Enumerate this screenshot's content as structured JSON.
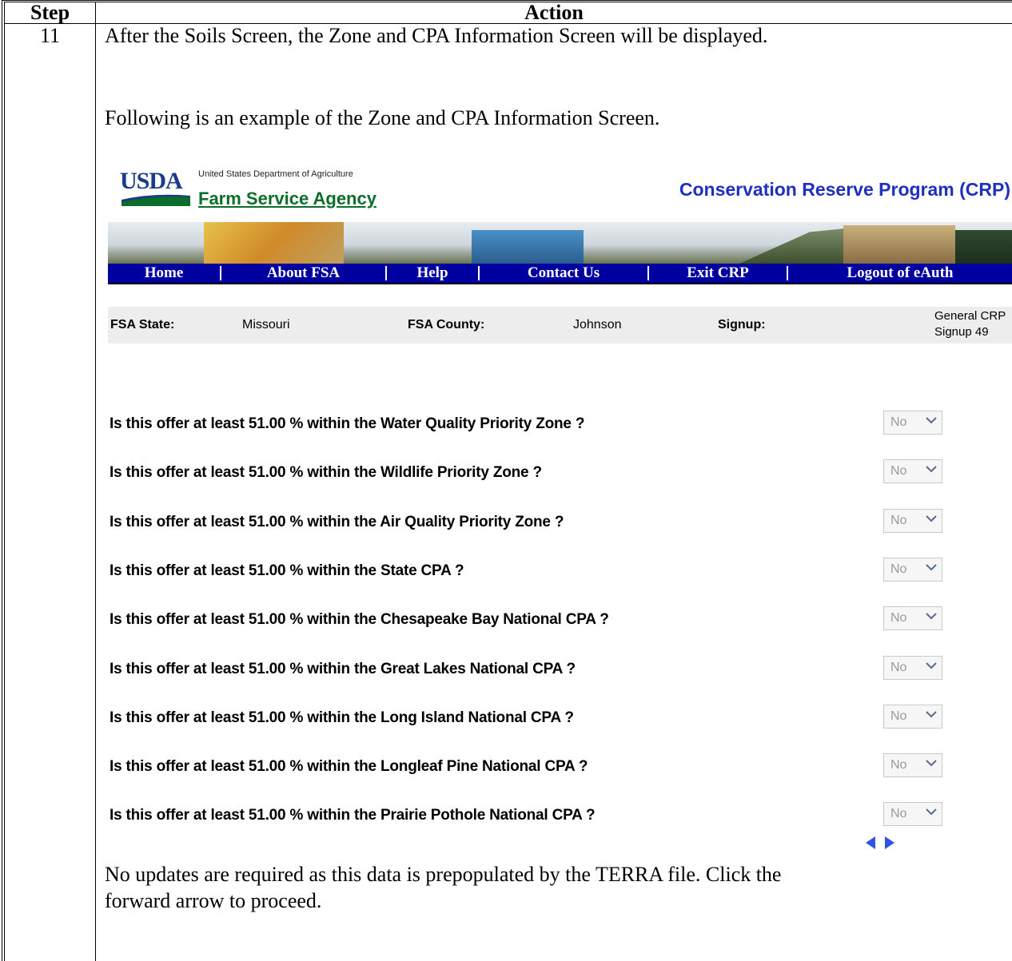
{
  "table": {
    "header_step": "Step",
    "header_action": "Action",
    "step_number": "11"
  },
  "paragraphs": {
    "p1": "After the Soils Screen, the Zone and CPA Information Screen will be displayed.",
    "p2": "Following is an example of the Zone and CPA Information Screen.",
    "p3_line1": "No updates are required as this data is prepopulated by the TERRA file.  Click the",
    "p3_line2": "forward arrow to proceed."
  },
  "app": {
    "logo_text": "USDA",
    "department": "United States Department of Agriculture",
    "agency": "Farm Service Agency",
    "program_title": "Conservation Reserve Program (CRP)",
    "nav": [
      "Home",
      "About FSA",
      "Help",
      "Contact Us",
      "Exit CRP",
      "Logout of eAuth"
    ],
    "info": {
      "state_label": "FSA State:",
      "state_value": "Missouri",
      "county_label": "FSA County:",
      "county_value": "Johnson",
      "signup_label": "Signup:",
      "signup_value_line1": "General CRP",
      "signup_value_line2": "Signup 49"
    },
    "questions": [
      {
        "text": "Is this offer at least 51.00 %  within the Water Quality Priority Zone ?",
        "value": "No"
      },
      {
        "text": "Is this offer at least 51.00 %  within the Wildlife Priority Zone ?",
        "value": "No"
      },
      {
        "text": "Is this offer at least 51.00 %  within the Air Quality Priority Zone ?",
        "value": "No"
      },
      {
        "text": "Is this offer at least 51.00 %  within the State CPA ?",
        "value": "No"
      },
      {
        "text": "Is this offer at least 51.00 %  within the Chesapeake Bay National CPA ?",
        "value": "No"
      },
      {
        "text": "Is this offer at least 51.00 %  within the Great Lakes National CPA ?",
        "value": "No"
      },
      {
        "text": "Is this offer at least 51.00 %  within the Long Island National CPA ?",
        "value": "No"
      },
      {
        "text": "Is this offer at least 51.00 %  within the Longleaf Pine National CPA ?",
        "value": "No"
      },
      {
        "text": "Is this offer at least 51.00 %  within the Prairie Pothole National CPA ?",
        "value": "No"
      }
    ],
    "colors": {
      "nav_bg": "#0000a0",
      "title_blue": "#1f2fbf",
      "agency_green": "#0a6e2a",
      "arrow_blue": "#2f54e0"
    }
  }
}
